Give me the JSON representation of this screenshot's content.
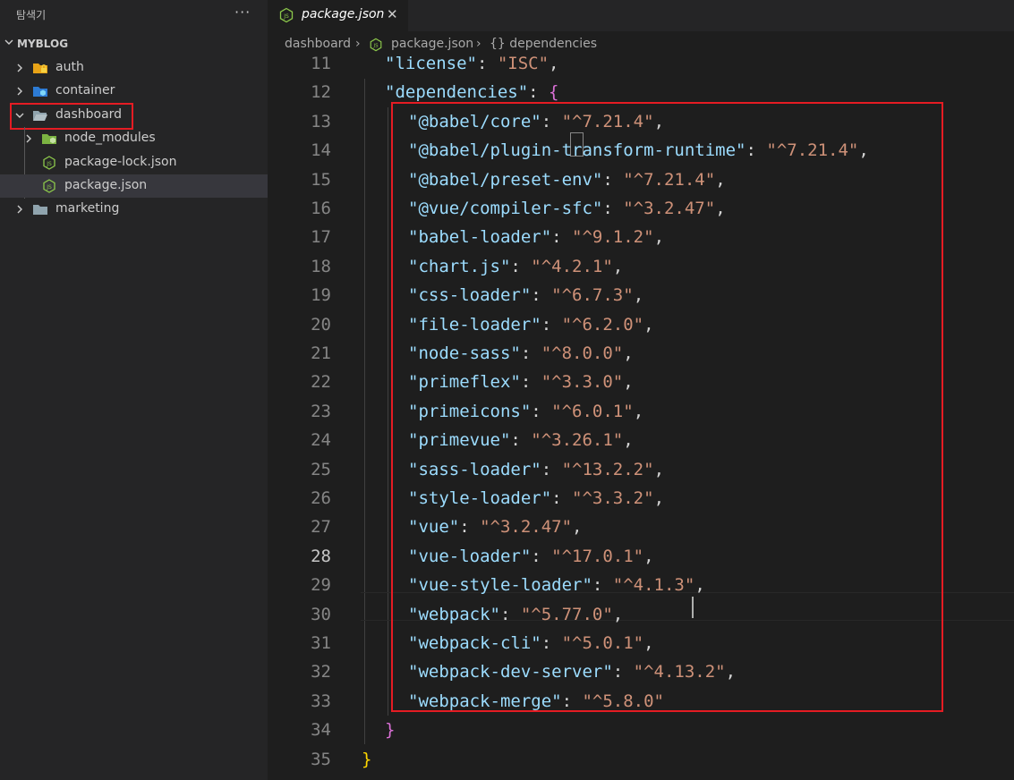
{
  "sidebar": {
    "title": "탐색기",
    "more": "···",
    "root": "MYBLOG",
    "items": [
      {
        "label": "auth"
      },
      {
        "label": "container"
      },
      {
        "label": "dashboard"
      },
      {
        "label": "node_modules"
      },
      {
        "label": "package-lock.json"
      },
      {
        "label": "package.json"
      },
      {
        "label": "marketing"
      }
    ]
  },
  "tab": {
    "label": "package.json",
    "close": "✕",
    "icon": "js-file-icon"
  },
  "breadcrumb": {
    "part1": "dashboard",
    "sep": "›",
    "part2": "package.json",
    "part3": "{} dependencies"
  },
  "code": {
    "line_numbers": [
      "11",
      "12",
      "13",
      "14",
      "15",
      "16",
      "17",
      "18",
      "19",
      "20",
      "21",
      "22",
      "23",
      "24",
      "25",
      "26",
      "27",
      "28",
      "29",
      "30",
      "31",
      "32",
      "33",
      "34",
      "35"
    ],
    "current_line": "28",
    "license_key": "\"license\"",
    "license_value": "\"ISC\"",
    "dependencies_key": "\"dependencies\"",
    "dependencies": [
      {
        "name": "\"@babel/core\"",
        "version": "\"^7.21.4\""
      },
      {
        "name": "\"@babel/plugin-transform-runtime\"",
        "version": "\"^7.21.4\""
      },
      {
        "name": "\"@babel/preset-env\"",
        "version": "\"^7.21.4\""
      },
      {
        "name": "\"@vue/compiler-sfc\"",
        "version": "\"^3.2.47\""
      },
      {
        "name": "\"babel-loader\"",
        "version": "\"^9.1.2\""
      },
      {
        "name": "\"chart.js\"",
        "version": "\"^4.2.1\""
      },
      {
        "name": "\"css-loader\"",
        "version": "\"^6.7.3\""
      },
      {
        "name": "\"file-loader\"",
        "version": "\"^6.2.0\""
      },
      {
        "name": "\"node-sass\"",
        "version": "\"^8.0.0\""
      },
      {
        "name": "\"primeflex\"",
        "version": "\"^3.3.0\""
      },
      {
        "name": "\"primeicons\"",
        "version": "\"^6.0.1\""
      },
      {
        "name": "\"primevue\"",
        "version": "\"^3.26.1\""
      },
      {
        "name": "\"sass-loader\"",
        "version": "\"^13.2.2\""
      },
      {
        "name": "\"style-loader\"",
        "version": "\"^3.3.2\""
      },
      {
        "name": "\"vue\"",
        "version": "\"^3.2.47\""
      },
      {
        "name": "\"vue-loader\"",
        "version": "\"^17.0.1\""
      },
      {
        "name": "\"vue-style-loader\"",
        "version": "\"^4.1.3\""
      },
      {
        "name": "\"webpack\"",
        "version": "\"^5.77.0\""
      },
      {
        "name": "\"webpack-cli\"",
        "version": "\"^5.0.1\""
      },
      {
        "name": "\"webpack-dev-server\"",
        "version": "\"^4.13.2\""
      },
      {
        "name": "\"webpack-merge\"",
        "version": "\"^5.8.0\""
      }
    ],
    "colon": ": ",
    "comma": ",",
    "open_brace": "{",
    "close_inner": "}",
    "close_outer": "}"
  },
  "colors": {
    "highlight_box": "#e51c23",
    "key": "#9cdcfe",
    "string": "#ce9178",
    "bracket": "#ffd700"
  }
}
